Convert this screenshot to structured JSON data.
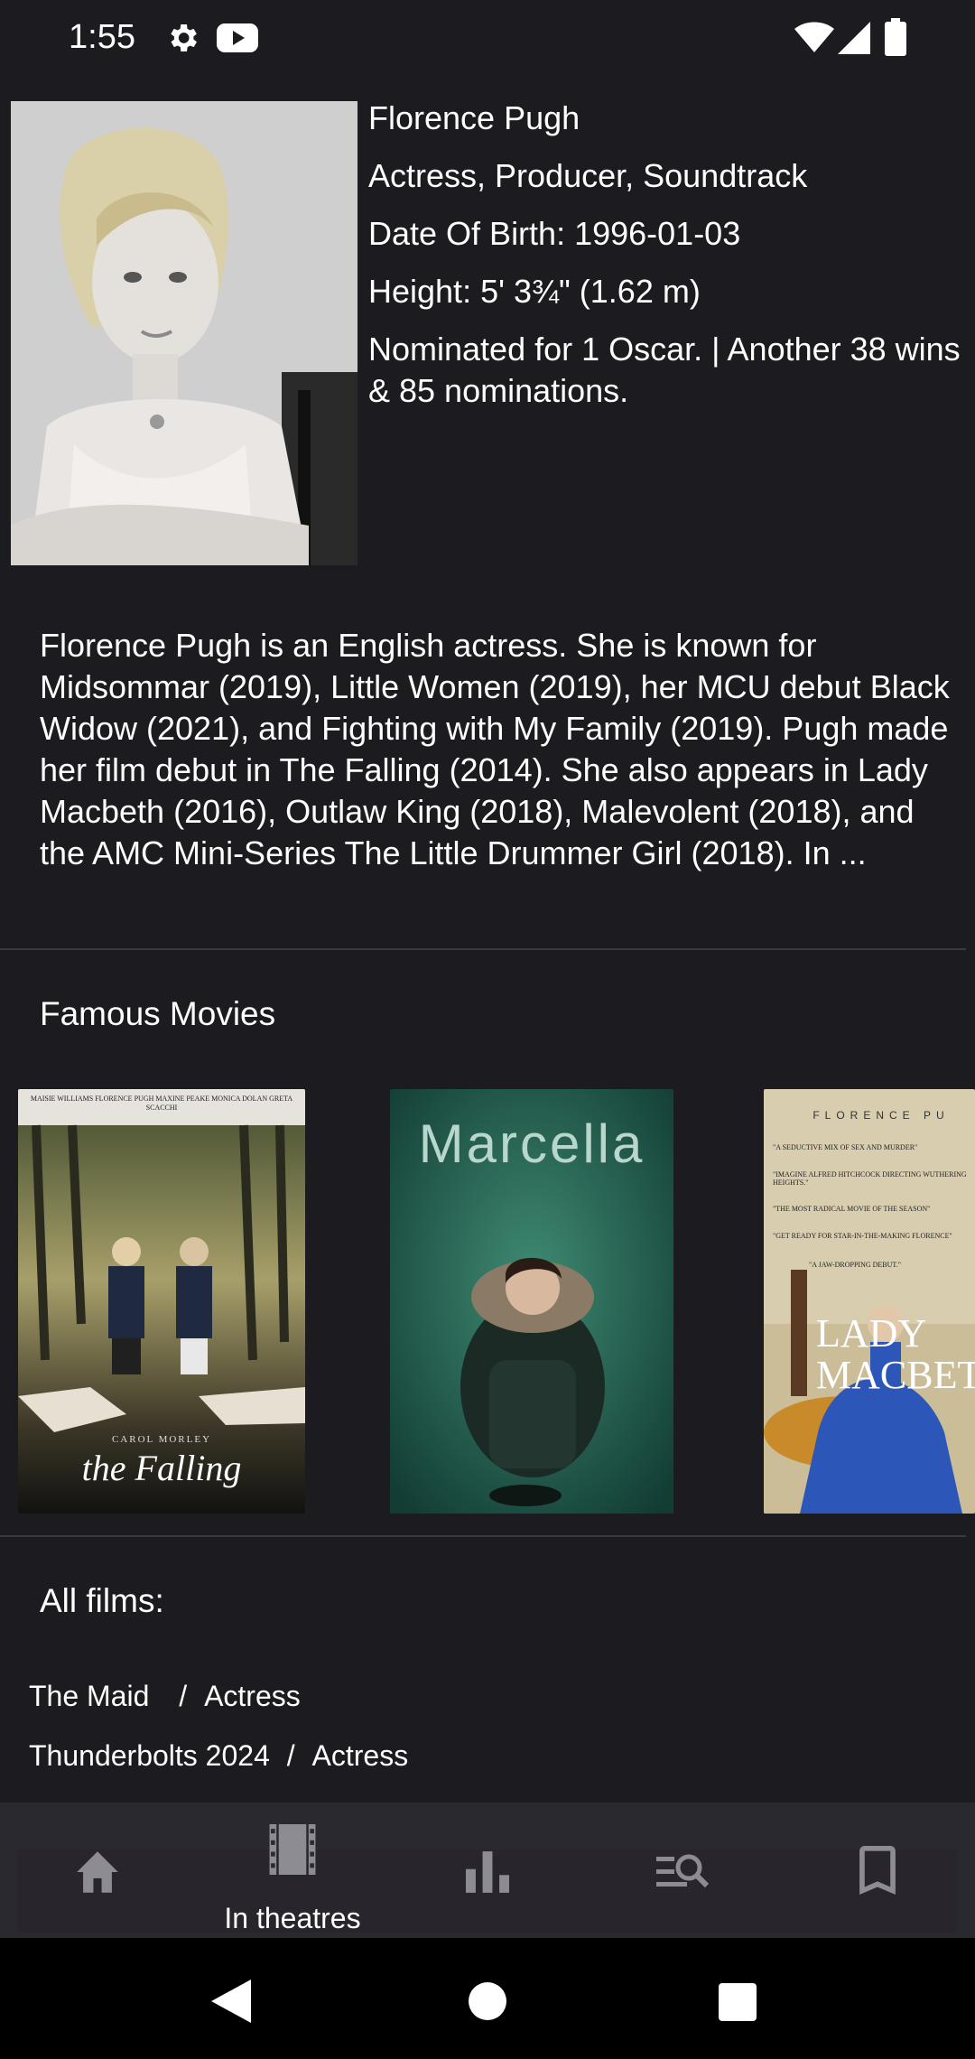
{
  "status_bar": {
    "time": "1:55",
    "icons": [
      "gear-icon",
      "youtube-icon",
      "wifi-icon",
      "signal-icon",
      "battery-icon"
    ]
  },
  "profile": {
    "name": "Florence Pugh",
    "roles": "Actress, Producer, Soundtrack",
    "birth": "Date Of Birth: 1996-01-03",
    "height": "Height: 5' 3¾\" (1.62 m)",
    "awards": "Nominated for 1 Oscar. | Another 38 wins & 85 nominations."
  },
  "bio": "Florence Pugh is an English actress. She is known for Midsommar (2019), Little Women (2019), her MCU debut Black Widow (2021), and Fighting with My Family (2019). Pugh made her film debut in The Falling (2014). She also appears in Lady Macbeth (2016), Outlaw King (2018), Malevolent (2018), and the AMC Mini-Series The Little Drummer Girl (2018). In ...",
  "famous_movies": {
    "title": "Famous Movies",
    "posters": [
      {
        "title": "the Falling",
        "credits": "MAISIE WILLIAMS   FLORENCE PUGH   MAXINE PEAKE   MONICA DOLAN   GRETA SCACCHI",
        "director": "CAROL MORLEY"
      },
      {
        "title": "Marcella"
      },
      {
        "title": "LADY MACBETH",
        "header": "FLORENCE PU",
        "quotes": [
          "\"A SEDUCTIVE MIX OF SEX AND MURDER\"",
          "\"IMAGINE ALFRED HITCHCOCK DIRECTING WUTHERING HEIGHTS.\"",
          "\"THE MOST RADICAL MOVIE OF THE SEASON\"",
          "\"GET READY FOR STAR-IN-THE-MAKING FLORENCE\"",
          "\"A JAW-DROPPING DEBUT.\""
        ]
      }
    ]
  },
  "all_films": {
    "title": "All films:",
    "items": [
      {
        "name": "The Maid",
        "sep": "/",
        "role": "Actress"
      },
      {
        "name": "Thunderbolts 2024",
        "sep": "/",
        "role": "Actress"
      }
    ]
  },
  "bottom_nav": {
    "items": [
      {
        "icon": "home-icon",
        "label": ""
      },
      {
        "icon": "film-icon",
        "label": "In theatres"
      },
      {
        "icon": "bar-chart-icon",
        "label": ""
      },
      {
        "icon": "search-list-icon",
        "label": ""
      },
      {
        "icon": "bookmark-icon",
        "label": ""
      }
    ]
  },
  "system_nav": {
    "icons": [
      "back-icon",
      "home-circle-icon",
      "recents-icon"
    ]
  }
}
